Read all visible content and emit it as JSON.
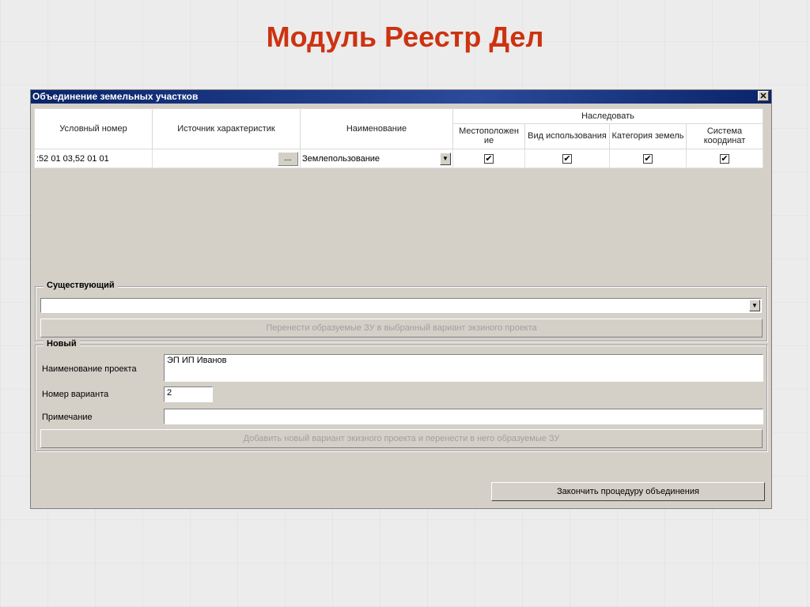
{
  "slide": {
    "title": "Модуль Реестр Дел"
  },
  "window": {
    "title": "Объединение земельных участков",
    "close_label": "✕"
  },
  "grid": {
    "headers": {
      "cond_number": "Условный номер",
      "source": "Источник характеристик",
      "name": "Наименование",
      "inherit": "Наследовать",
      "location": "Местоположен ие",
      "usage": "Вид использования",
      "category": "Категория земель",
      "coords": "Система координат"
    },
    "row": {
      "cond_number": ":52 01 03,52 01 01",
      "source": "",
      "source_button": "...",
      "name": "Землепользование",
      "location_check": "✔",
      "usage_check": "✔",
      "category_check": "✔",
      "coords_check": "✔"
    }
  },
  "existing": {
    "label": "Существующий",
    "value": "",
    "move_button": "Перенести образуемые ЗУ в выбранный вариант экзиного проекта"
  },
  "new": {
    "label": "Новый",
    "project_name_label": "Наименование проекта",
    "project_name_value": "ЭП ИП Иванов",
    "variant_label": "Номер варианта",
    "variant_value": "2",
    "note_label": "Примечание",
    "note_value": "",
    "add_button": "Добавить новый вариант экизного проекта и перенести в него образуемые ЗУ"
  },
  "finish_button": "Закончить процедуру объединения",
  "icons": {
    "dropdown": "▼",
    "checkmark": "✔"
  }
}
